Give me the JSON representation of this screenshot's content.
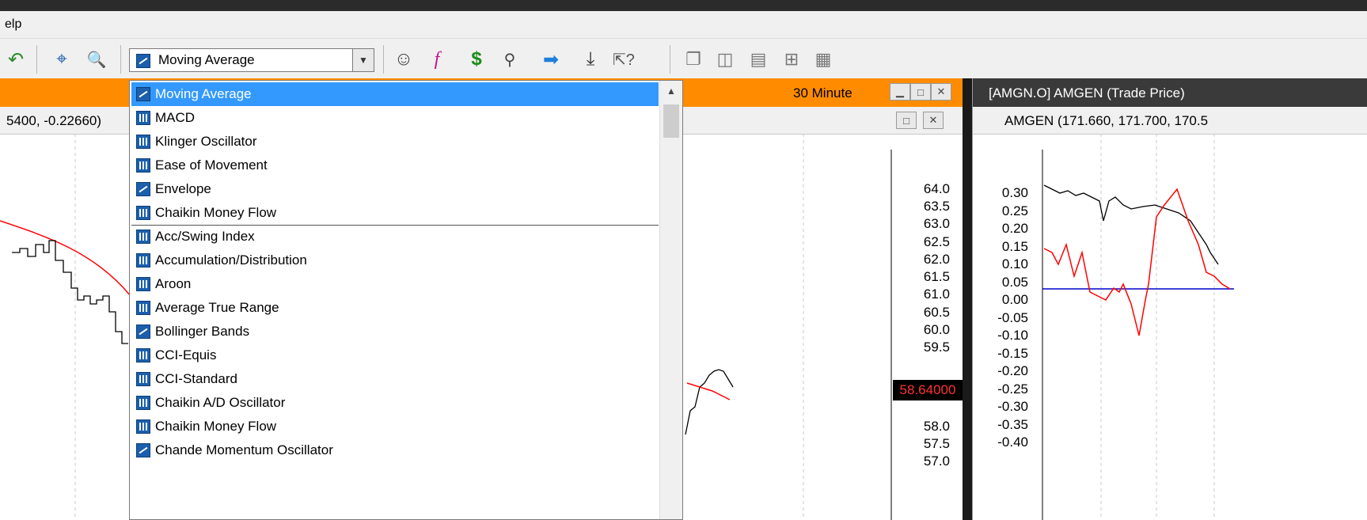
{
  "menu": {
    "partial_label": "elp"
  },
  "toolbar": {
    "indicator_select": {
      "value": "Moving Average"
    }
  },
  "dropdown": {
    "items": [
      {
        "label": "Moving Average",
        "icon": "line-indicator-icon",
        "selected": true
      },
      {
        "label": "MACD",
        "icon": "bar-indicator-icon"
      },
      {
        "label": "Klinger Oscillator",
        "icon": "bar-indicator-icon"
      },
      {
        "label": "Ease of Movement",
        "icon": "bar-indicator-icon"
      },
      {
        "label": "Envelope",
        "icon": "line-indicator-icon"
      },
      {
        "label": "Chaikin Money Flow",
        "icon": "bar-indicator-icon"
      },
      {
        "label": "Acc/Swing Index",
        "icon": "bar-indicator-icon"
      },
      {
        "label": "Accumulation/Distribution",
        "icon": "bar-indicator-icon"
      },
      {
        "label": "Aroon",
        "icon": "bar-indicator-icon"
      },
      {
        "label": "Average True Range",
        "icon": "bar-indicator-icon"
      },
      {
        "label": "Bollinger Bands",
        "icon": "line-indicator-icon"
      },
      {
        "label": "CCI-Equis",
        "icon": "bar-indicator-icon"
      },
      {
        "label": "CCI-Standard",
        "icon": "bar-indicator-icon"
      },
      {
        "label": "Chaikin A/D Oscillator",
        "icon": "bar-indicator-icon"
      },
      {
        "label": "Chaikin Money Flow",
        "icon": "bar-indicator-icon"
      },
      {
        "label": "Chande Momentum Oscillator",
        "icon": "line-indicator-icon"
      }
    ]
  },
  "left_chart": {
    "interval": "30 Minute",
    "sub_values": "5400, -0.22660)",
    "price_axis": [
      "64.0",
      "63.5",
      "63.0",
      "62.5",
      "62.0",
      "61.5",
      "61.0",
      "60.5",
      "60.0",
      "59.5",
      "58.0",
      "57.5",
      "57.0"
    ],
    "last_price": "58.64000"
  },
  "right_chart": {
    "title": "[AMGN.O] AMGEN (Trade Price)",
    "sub_values": "AMGEN (171.660, 171.700, 170.5",
    "axis": [
      "0.30",
      "0.25",
      "0.20",
      "0.15",
      "0.10",
      "0.05",
      "0.00",
      "-0.05",
      "-0.10",
      "-0.15",
      "-0.20",
      "-0.25",
      "-0.30",
      "-0.35",
      "-0.40"
    ]
  },
  "colors": {
    "accent_orange": "#ff8c00",
    "selection_blue": "#3399ff",
    "indicator_red": "#ff0000",
    "zero_line": "#0000cc"
  }
}
